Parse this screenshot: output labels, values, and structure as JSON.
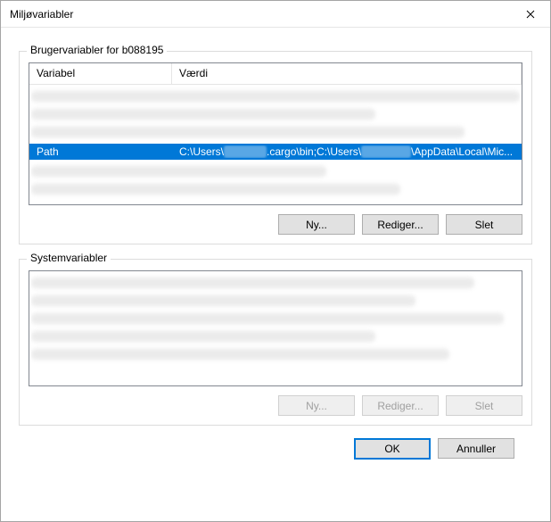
{
  "window": {
    "title": "Miljøvariabler"
  },
  "user_group": {
    "label": "Brugervariabler for b088195",
    "columns": {
      "variable": "Variabel",
      "value": "Værdi"
    },
    "rows": [
      {
        "variable": "Path",
        "value_segments": [
          "C:\\Users\\",
          ".cargo\\bin;C:\\Users\\",
          "\\AppData\\Local\\Mic..."
        ],
        "selected": true
      }
    ],
    "buttons": {
      "new": "Ny...",
      "edit": "Rediger...",
      "delete": "Slet"
    }
  },
  "system_group": {
    "label": "Systemvariabler",
    "buttons": {
      "new": "Ny...",
      "edit": "Rediger...",
      "delete": "Slet"
    }
  },
  "footer": {
    "ok": "OK",
    "cancel": "Annuller"
  }
}
